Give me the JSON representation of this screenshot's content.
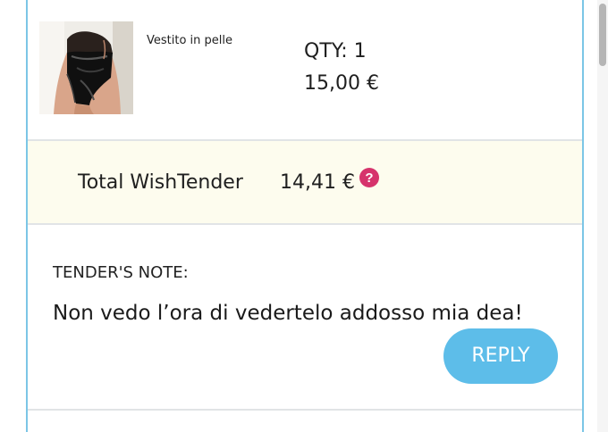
{
  "item": {
    "name": "Vestito in pelle",
    "qty": "QTY: 1",
    "price": "15,00 €",
    "thumbnail_icon": "dress-photo"
  },
  "total": {
    "label": "Total WishTender",
    "value": "14,41 €",
    "help_icon": "question-mark-icon",
    "help_symbol": "?"
  },
  "note": {
    "title": "TENDER'S NOTE:",
    "body": "Non vedo l’ora di vedertelo addosso mia dea!",
    "reply_label": "REPLY"
  },
  "colors": {
    "border_accent": "#7cc6e6",
    "total_background": "#fdfcee",
    "reply_button": "#5dbde9",
    "help_icon": "#d6336c"
  }
}
